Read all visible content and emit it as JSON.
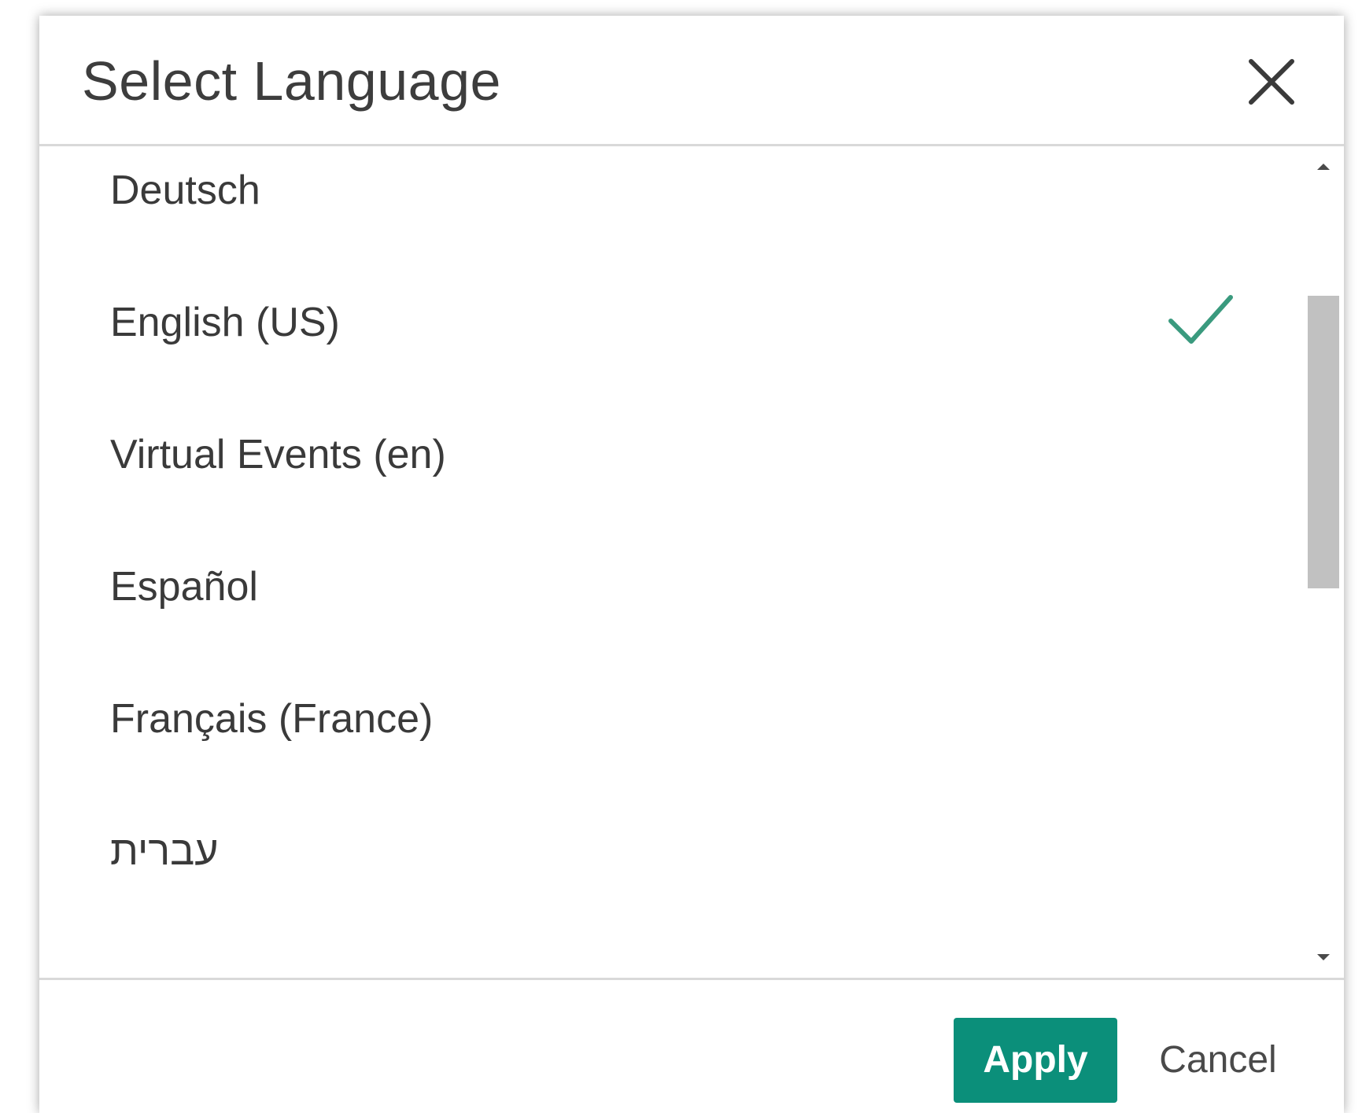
{
  "dialog": {
    "title": "Select Language",
    "close_icon": "close-icon"
  },
  "languages": [
    {
      "label": "Deutsch",
      "selected": false
    },
    {
      "label": "English (US)",
      "selected": true
    },
    {
      "label": "Virtual Events (en)",
      "selected": false
    },
    {
      "label": "Español",
      "selected": false
    },
    {
      "label": "Français (France)",
      "selected": false
    },
    {
      "label": "עברית",
      "selected": false
    }
  ],
  "footer": {
    "apply_label": "Apply",
    "cancel_label": "Cancel"
  },
  "colors": {
    "accent": "#0b8f7a",
    "check": "#3a9a7e",
    "text": "#3a3a3a"
  }
}
